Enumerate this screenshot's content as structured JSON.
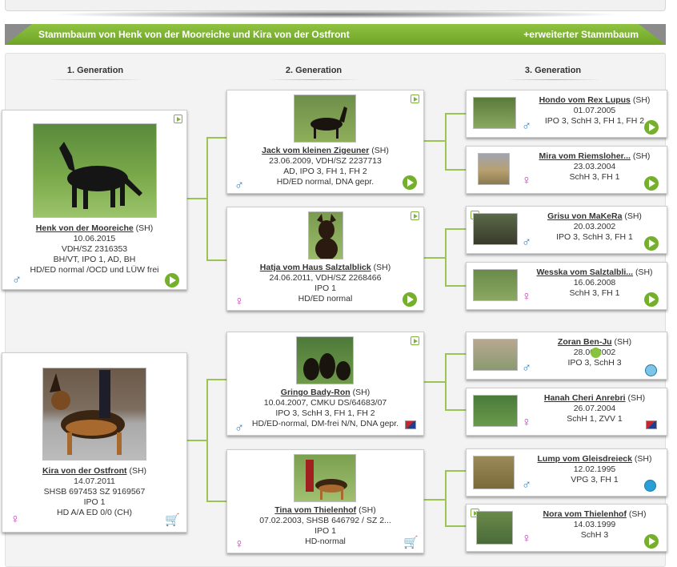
{
  "banner": {
    "title": "Stammbaum von Henk von der Mooreiche und Kira von der Ostfront",
    "extended_link": "+erweiterter Stammbaum"
  },
  "generations": [
    "1. Generation",
    "2. Generation",
    "3. Generation"
  ],
  "colors": {
    "banner_green": "#7ab232",
    "male_blue": "#2a7bc0",
    "female_pink": "#c23fb5",
    "line_green": "#9cc455"
  },
  "gen1": [
    {
      "name": "Henk von der Mooreiche",
      "suffix": "(SH)",
      "lines": [
        "10.06.2015",
        "VDH/SZ 2316353",
        "BH/VT, IPO 1, AD, BH",
        "HD/ED normal /OCD und LÜW frei"
      ],
      "sex": "male",
      "sex_symbol": "♂"
    },
    {
      "name": "Kira von der Ostfront",
      "suffix": "(SH)",
      "lines": [
        "14.07.2011",
        "SHSB 697453 SZ 9169567",
        "IPO 1",
        "HD A/A ED 0/0 (CH)"
      ],
      "sex": "female",
      "sex_symbol": "♀"
    }
  ],
  "gen2": [
    {
      "name": "Jack vom kleinen Zigeuner",
      "suffix": "(SH)",
      "lines": [
        "23.06.2009, VDH/SZ 2237713",
        "AD, IPO 3, FH 1, FH 2",
        "HD/ED normal, DNA gepr."
      ],
      "sex_symbol": "♂"
    },
    {
      "name": "Hatja vom Haus Salztalblick",
      "suffix": "(SH)",
      "lines": [
        "24.06.2011, VDH/SZ 2268466",
        "IPO 1",
        "HD/ED normal"
      ],
      "sex_symbol": "♀"
    },
    {
      "name": "Gringo Bady-Ron",
      "suffix": "(SH)",
      "lines": [
        "10.04.2007, CMKU DS/64683/07",
        "IPO 3, SchH 3, FH 1, FH 2",
        "HD/ED-normal, DM-frei N/N, DNA gepr."
      ],
      "sex_symbol": "♂"
    },
    {
      "name": "Tina vom Thielenhof",
      "suffix": "(SH)",
      "lines": [
        "07.02.2003,  SHSB 646792 / SZ 2...",
        "IPO 1",
        "HD-normal"
      ],
      "sex_symbol": "♀"
    }
  ],
  "gen3": [
    {
      "name": "Hondo vom Rex Lupus",
      "suffix": "(SH)",
      "lines": [
        "01.07.2005",
        "IPO 3, SchH 3, FH 1, FH 2"
      ],
      "sex_symbol": "♂"
    },
    {
      "name": "Mira vom Riemsloher...",
      "suffix": "(SH)",
      "lines": [
        "23.03.2004",
        "SchH 3, FH 1"
      ],
      "sex_symbol": "♀"
    },
    {
      "name": "Grisu von MaKeRa",
      "suffix": "(SH)",
      "lines": [
        "20.03.2002",
        "IPO 3, SchH 3, FH 1"
      ],
      "sex_symbol": "♂"
    },
    {
      "name": "Wesska vom Salztalbli...",
      "suffix": "(SH)",
      "lines": [
        "16.06.2008",
        "SchH 3, FH 1"
      ],
      "sex_symbol": "♀"
    },
    {
      "name": "Zoran Ben-Ju",
      "suffix": "(SH)",
      "lines": [
        "28.06.2002",
        "IPO 3, SchH 3"
      ],
      "sex_symbol": "♂"
    },
    {
      "name": "Hanah Cheri Anrebri",
      "suffix": "(SH)",
      "lines": [
        "26.07.2004",
        "SchH 1, ZVV 1"
      ],
      "sex_symbol": "♀"
    },
    {
      "name": "Lump vom Gleisdreieck",
      "suffix": "(SH)",
      "lines": [
        "12.02.1995",
        "VPG 3, FH 1"
      ],
      "sex_symbol": "♂"
    },
    {
      "name": "Nora vom Thielenhof",
      "suffix": "(SH)",
      "lines": [
        "14.03.1999",
        "SchH 3"
      ],
      "sex_symbol": "♀"
    }
  ]
}
